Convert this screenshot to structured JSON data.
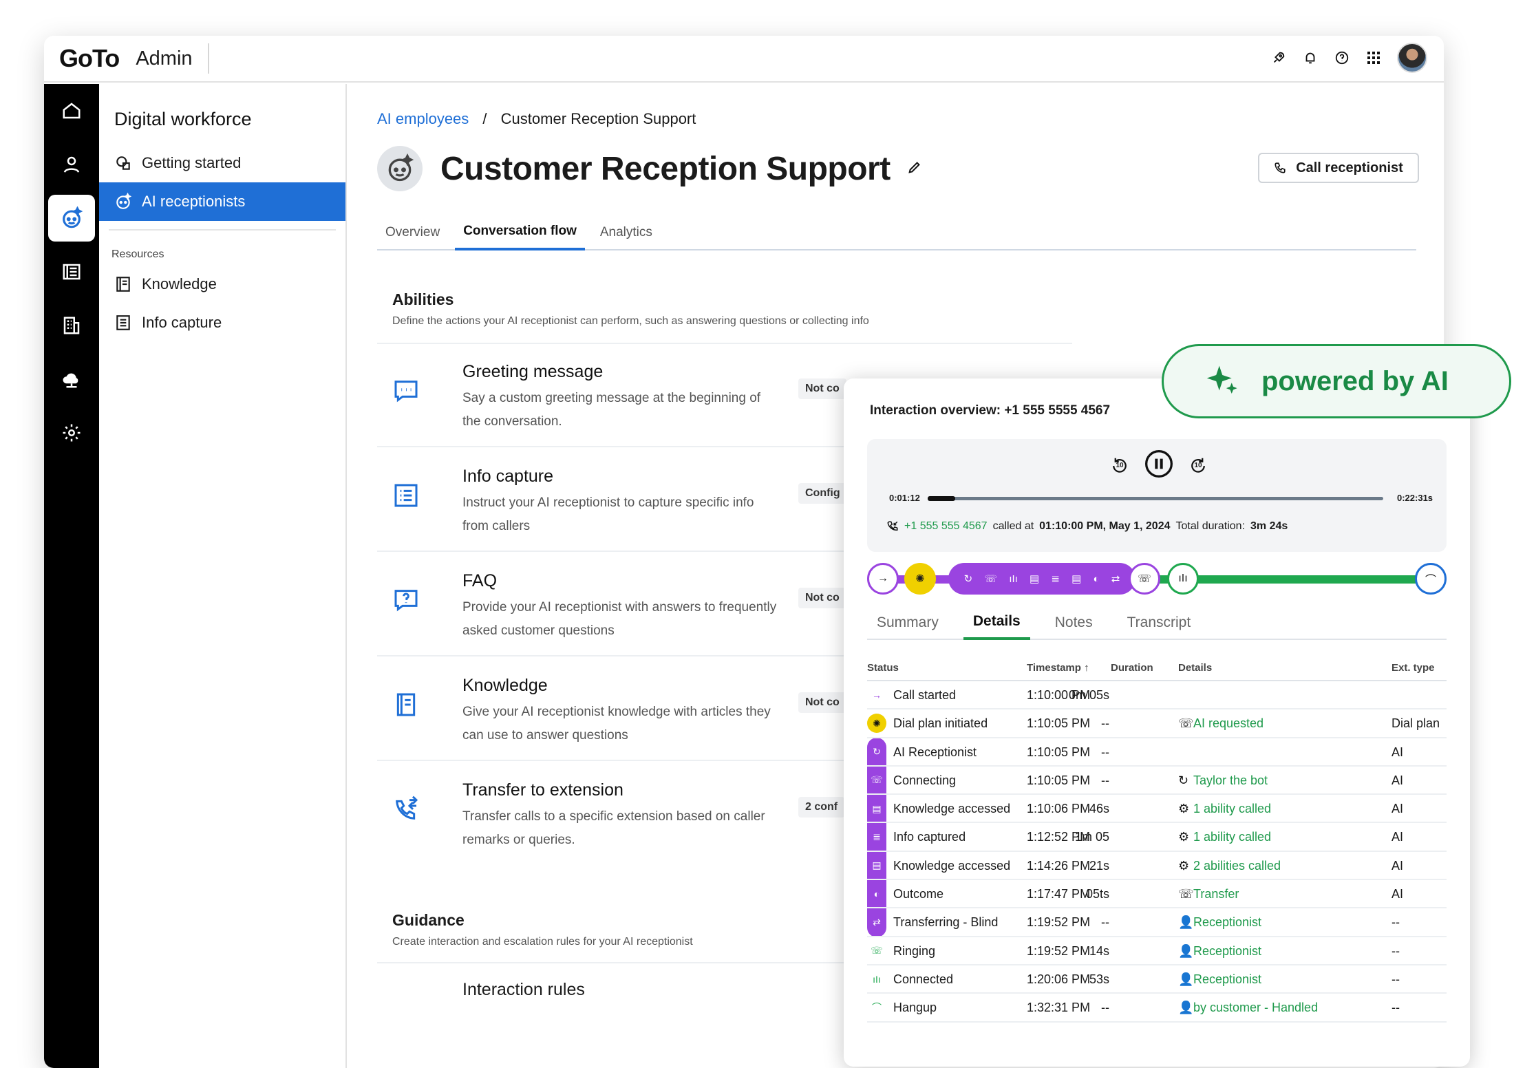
{
  "topbar": {
    "brand": "GoTo",
    "section": "Admin"
  },
  "sidebar": {
    "title": "Digital workforce",
    "items": [
      {
        "label": "Getting started"
      },
      {
        "label": "AI receptionists"
      }
    ],
    "resources_label": "Resources",
    "resources": [
      {
        "label": "Knowledge"
      },
      {
        "label": "Info capture"
      }
    ]
  },
  "breadcrumb": {
    "parent": "AI employees",
    "sep": "/",
    "current": "Customer Reception Support"
  },
  "page": {
    "title": "Customer Reception Support",
    "call_button": "Call receptionist",
    "more": "⋮"
  },
  "tabs": [
    "Overview",
    "Conversation flow",
    "Analytics"
  ],
  "abilities": {
    "title": "Abilities",
    "subtitle": "Define the actions your AI receptionist can perform, such as answering questions or collecting info",
    "items": [
      {
        "name": "Greeting message",
        "desc": "Say a custom greeting message at the beginning of the conversation.",
        "status": "Not co",
        "icon": "chat-icon"
      },
      {
        "name": "Info capture",
        "desc": "Instruct your AI receptionist to capture specific info from callers",
        "status": "Config",
        "icon": "list-icon"
      },
      {
        "name": "FAQ",
        "desc": "Provide your AI receptionist with answers to frequently asked customer questions",
        "status": "Not co",
        "icon": "question-icon"
      },
      {
        "name": "Knowledge",
        "desc": "Give your AI receptionist knowledge with articles they can use to answer questions",
        "status": "Not co",
        "icon": "book-icon"
      },
      {
        "name": "Transfer to extension",
        "desc": "Transfer calls to a specific extension based on caller remarks or queries.",
        "status": "2 conf",
        "icon": "transfer-icon"
      }
    ]
  },
  "guidance": {
    "title": "Guidance",
    "subtitle": "Create interaction and escalation rules for your AI receptionist",
    "first_item": "Interaction rules"
  },
  "badge": {
    "label": "powered by AI",
    "color": "#1a8a45"
  },
  "panel": {
    "title": "Interaction overview: +1 555 5555 4567",
    "player": {
      "rewind": "10",
      "forward": "10",
      "start": "0:01:12",
      "end": "0:22:31s",
      "caller": "+1 555 555 4567",
      "called_at_label": "called at",
      "called_at": "01:10:00 PM, May 1, 2024",
      "duration_label": "Total duration:",
      "duration": "3m 24s",
      "progress": 0.06
    },
    "tabs": [
      "Summary",
      "Details",
      "Notes",
      "Transcript"
    ],
    "columns": [
      "Status",
      "Timestamp ↑",
      "Duration",
      "Details",
      "Ext. type"
    ],
    "rows": [
      {
        "status": "Call started",
        "time": "1:10:00 PM",
        "dur": "0m 05s",
        "detail": "",
        "ext": "",
        "sicon": "→",
        "dicon": ""
      },
      {
        "status": "Dial plan initiated",
        "time": "1:10:05 PM",
        "dur": "--",
        "detail": "AI requested",
        "ext": "Dial plan",
        "sicon": "✺",
        "dicon": "☏"
      },
      {
        "status": "AI Receptionist",
        "time": "1:10:05 PM",
        "dur": "--",
        "detail": "",
        "ext": "AI",
        "sicon": "↻",
        "dicon": ""
      },
      {
        "status": "Connecting",
        "time": "1:10:05 PM",
        "dur": "--",
        "detail": "Taylor the bot",
        "ext": "AI",
        "sicon": "☏",
        "dicon": "↻"
      },
      {
        "status": "Knowledge accessed",
        "time": "1:10:06 PM",
        "dur": "46s",
        "detail": "1 ability called",
        "ext": "AI",
        "sicon": "▤",
        "dicon": "⚙"
      },
      {
        "status": "Info captured",
        "time": "1:12:52 PM",
        "dur": "1m 05",
        "detail": "1 ability called",
        "ext": "AI",
        "sicon": "≣",
        "dicon": "⚙"
      },
      {
        "status": "Knowledge accessed",
        "time": "1:14:26 PM",
        "dur": "21s",
        "detail": "2 abilities called",
        "ext": "AI",
        "sicon": "▤",
        "dicon": "⚙"
      },
      {
        "status": "Outcome",
        "time": "1:17:47 PM",
        "dur": "05ts",
        "detail": "Transfer",
        "ext": "AI",
        "sicon": "◐",
        "dicon": "☏"
      },
      {
        "status": "Transferring - Blind",
        "time": "1:19:52 PM",
        "dur": "--",
        "detail": "Receptionist",
        "ext": "--",
        "sicon": "⇄",
        "dicon": "👤"
      },
      {
        "status": "Ringing",
        "time": "1:19:52 PM",
        "dur": "14s",
        "detail": "Receptionist",
        "ext": "--",
        "sicon": "☏",
        "dicon": "👤"
      },
      {
        "status": "Connected",
        "time": "1:20:06 PM",
        "dur": "53s",
        "detail": "Receptionist",
        "ext": "--",
        "sicon": "ıIı",
        "dicon": "👤"
      },
      {
        "status": "Hangup",
        "time": "1:32:31 PM",
        "dur": "--",
        "detail": "by customer - Handled",
        "ext": "--",
        "sicon": "⌒",
        "dicon": "👤"
      }
    ]
  },
  "colors": {
    "accent": "#1f6fd6",
    "green": "#1fa84f",
    "purple": "#9a44e0",
    "yellow": "#f0d000"
  }
}
